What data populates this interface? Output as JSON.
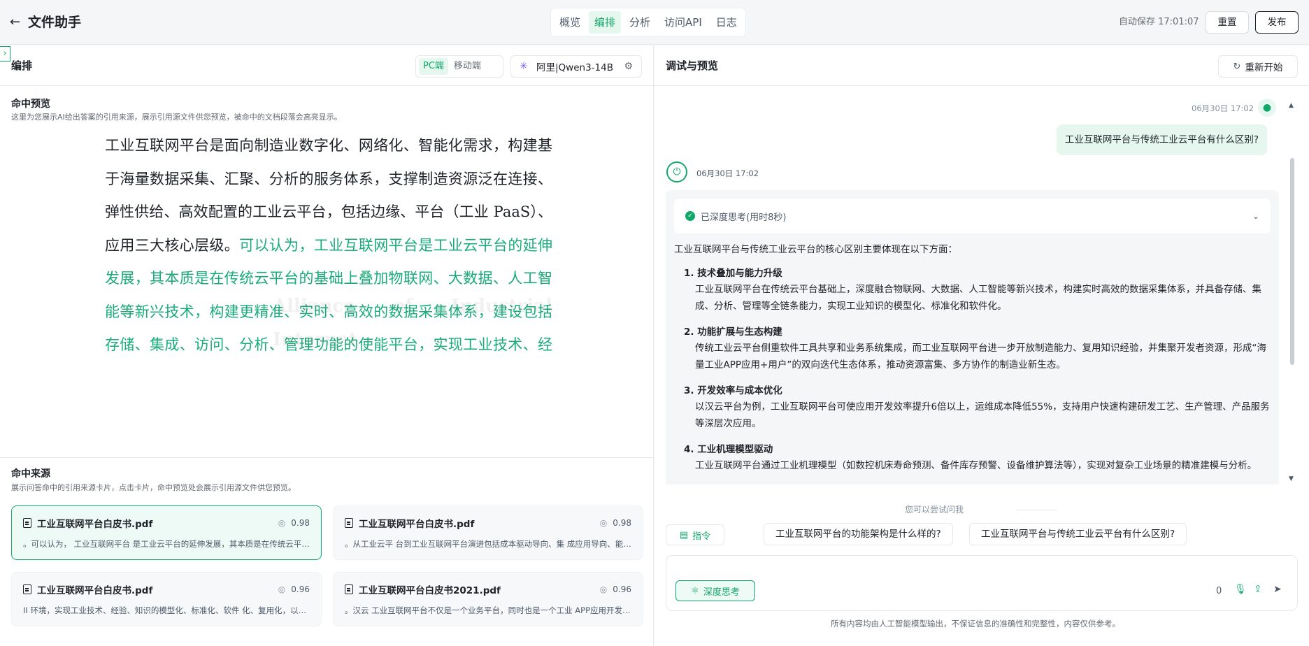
{
  "app": {
    "title": "文件助手"
  },
  "nav": {
    "tabs": [
      "概览",
      "编排",
      "分析",
      "访问API",
      "日志"
    ],
    "active": "编排"
  },
  "header": {
    "autosave": "自动保存 17:01:07",
    "reset_label": "重置",
    "publish_label": "发布"
  },
  "left": {
    "title": "编排",
    "device_options": [
      "PC端",
      "移动端"
    ],
    "model_name": "阿里|Qwen3-14B",
    "hit_preview": {
      "title": "命中预览",
      "desc": "这里为您展示AI给出答案的引用来源，展示引用源文件供您预览，被命中的文档段落会高亮显示。",
      "text_normal": "工业互联网平台是面向制造业数字化、网络化、智能化需求，构建基于海量数据采集、汇聚、分析的服务体系，支撑制造资源泛在连接、弹性供给、高效配置的工业云平台，包括边缘、平台（工业 PaaS）、应用三大核心层级。",
      "text_highlight": "可以认为，工业互联网平台是工业云平台的延伸发展，其本质是在传统云平台的基础上叠加物联网、大数据、人工智能等新兴技术，构建更精准、实时、高效的数据采集体系，建设包括存储、集成、访问、分析、管理功能的使能平台，实现工业技术、经验、知识模型化、软件化、复用化，以工业 APP 的形式为制造企业各类创新应用，最终形成资源富集、多方参与、合作共赢、协同演进的制造业生态。",
      "watermark": "Alliance of Industrial Internet"
    },
    "sources": {
      "title": "命中来源",
      "desc": "展示问答命中的引用来源卡片，点击卡片，命中预览处会展示引用源文件供您预览。",
      "cards": [
        {
          "name": "工业互联网平台白皮书.pdf",
          "score": "0.98",
          "text": "。可以认为， 工业互联网平台 是工业云平台的延伸发展，其本质是在传统云平台的基础上叠加物联网",
          "selected": true
        },
        {
          "name": "工业互联网平台白皮书.pdf",
          "score": "0.98",
          "text": "。从工业云平 台到工业互联网平台演进包括成本驱动导向、集 成应用导向、能力交易导向、创新引领导向",
          "selected": false
        },
        {
          "name": "工业互联网平台白皮书.pdf",
          "score": "0.96",
          "text": "II 环境，实现工业技术、经验、知识的模型化、标准化、软件 化、复用化，以工业微服务的形式",
          "selected": false
        },
        {
          "name": "工业互联网平台白皮书2021.pdf",
          "score": "0.96",
          "text": "。汉云 工业互联网平台不仅是一个业务平台，同时也是一个工业 APP应用开发平台",
          "selected": false
        }
      ]
    }
  },
  "right": {
    "title": "调试与预览",
    "restart_label": "重新开始",
    "user_time": "06月30日 17:02",
    "user_question": "工业互联网平台与传统工业云平台有什么区别?",
    "bot_time": "06月30日 17:02",
    "think_label": "已深度思考(用时8秒)",
    "answer_intro": "工业互联网平台与传统工业云平台的核心区别主要体现在以下方面：",
    "answer_items": [
      {
        "head": "1. 技术叠加与能力升级",
        "body": "工业互联网平台在传统云平台基础上，深度融合物联网、大数据、人工智能等新兴技术，构建实时高效的数据采集体系，并具备存储、集成、分析、管理等全链条能力，实现工业知识的模型化、标准化和软件化。"
      },
      {
        "head": "2. 功能扩展与生态构建",
        "body": "传统工业云平台侧重软件工具共享和业务系统集成，而工业互联网平台进一步开放制造能力、复用知识经验，并集聚开发者资源，形成“海量工业APP应用+用户”的双向迭代生态体系，推动资源富集、多方协作的制造业新生态。"
      },
      {
        "head": "3. 开发效率与成本优化",
        "body": "以汉云平台为例，工业互联网平台可使应用开发效率提升6倍以上，运维成本降低55%，支持用户快速构建研发工艺、生产管理、产品服务等深层次应用。"
      },
      {
        "head": "4. 工业机理模型驱动",
        "body": "工业互联网平台通过工业机理模型（如数控机床寿命预测、备件库存预警、设备维护算法等），实现对复杂工业场景的精准建模与分析。"
      }
    ],
    "suggest_label": "您可以尝试问我",
    "command_label": "指令",
    "suggestions": [
      "工业互联网平台的功能架构是什么样的?",
      "工业互联网平台与传统工业云平台有什么区别?"
    ],
    "input_placeholder": "",
    "deep_think_label": "深度思考",
    "char_count": "0",
    "disclaimer": "所有内容均由人工智能模型输出，不保证信息的准确性和完整性，内容仅供参考。"
  },
  "icons": {
    "back": "arrow-left-icon",
    "collapse": "chevron-right-icon",
    "model": "model-logo-icon",
    "settings": "gear-icon",
    "restart": "refresh-icon",
    "user": "user-icon",
    "bot": "bot-icon",
    "check": "check-icon",
    "chevron": "chevron-down-icon",
    "file": "file-icon",
    "score": "score-icon",
    "command": "command-icon",
    "deep_think": "atom-icon",
    "mic": "mic-icon",
    "upload": "upload-icon",
    "send": "send-icon"
  },
  "colors": {
    "accent": "#12a86b",
    "highlight_text": "#1aab78",
    "accent_light": "#e6f7ef"
  }
}
